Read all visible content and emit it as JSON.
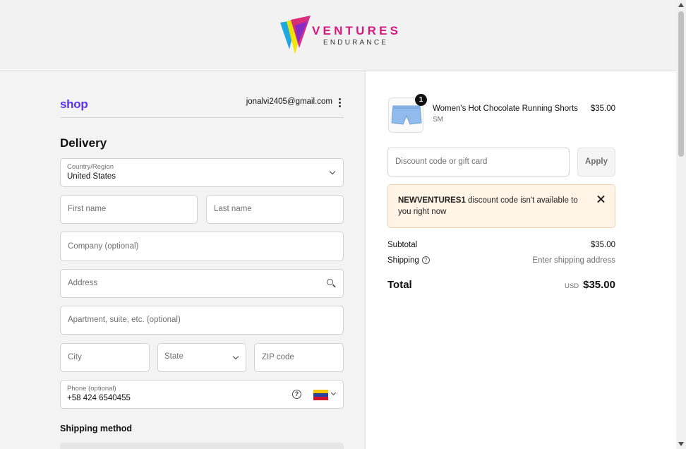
{
  "brand": {
    "name": "VENTURES",
    "subtitle": "ENDURANCE",
    "colors": [
      "#1ea7e1",
      "#f5e400",
      "#d6197f",
      "#7a2bd0"
    ]
  },
  "account": {
    "shop_logo": "shop",
    "email": "jonalvi2405@gmail.com"
  },
  "delivery": {
    "heading": "Delivery",
    "country_label": "Country/Region",
    "country_value": "United States",
    "first_name_placeholder": "First name",
    "last_name_placeholder": "Last name",
    "company_placeholder": "Company (optional)",
    "address_placeholder": "Address",
    "apartment_placeholder": "Apartment, suite, etc. (optional)",
    "city_placeholder": "City",
    "state_placeholder": "State",
    "zip_placeholder": "ZIP code",
    "phone_label": "Phone (optional)",
    "phone_value": "+58 424 6540455",
    "phone_country_flag": "venezuela-flag"
  },
  "shipping": {
    "heading": "Shipping method"
  },
  "cart": {
    "item": {
      "name": "Women's Hot Chocolate Running Shorts",
      "variant": "SM",
      "price": "$35.00",
      "quantity": "1"
    },
    "discount_placeholder": "Discount code or gift card",
    "apply_label": "Apply",
    "alert": {
      "code": "NEWVENTURES1",
      "message": " discount code isn't available to you right now"
    },
    "subtotal_label": "Subtotal",
    "subtotal_value": "$35.00",
    "shipping_label": "Shipping",
    "shipping_value": "Enter shipping address",
    "total_label": "Total",
    "total_currency": "USD",
    "total_value": "$35.00"
  }
}
